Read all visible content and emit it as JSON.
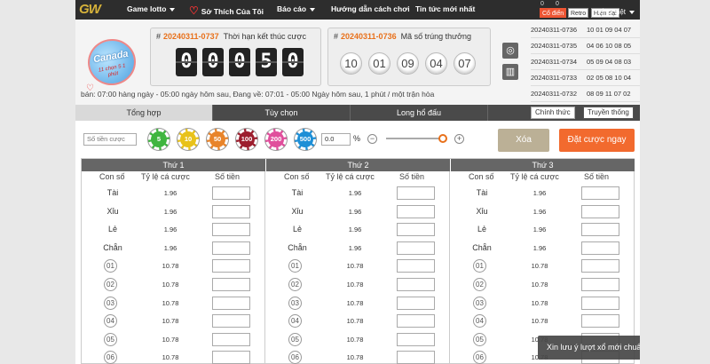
{
  "nav": {
    "logo": "GW",
    "items": [
      {
        "label": "Game lotto",
        "caret": true
      },
      {
        "label": "Sở Thích Của Tôi",
        "caret": false,
        "heart": true
      },
      {
        "label": "Báo cáo",
        "caret": true
      },
      {
        "label": "Hướng dẫn cách chơi",
        "caret": false
      },
      {
        "label": "Tin tức mới nhất",
        "caret": false
      }
    ],
    "mini_values": [
      "0",
      "0"
    ],
    "style_buttons": [
      "Cổ điển",
      "Retro",
      "Hiện đại"
    ],
    "language": "Tiếng Việt"
  },
  "badge": {
    "title": "Canada",
    "subtitle": "11 chọn 5 1 phút"
  },
  "countdown": {
    "draw_id": "20240311-0737",
    "label": "Thời hạn kết thúc cược",
    "digits": [
      "0",
      "0",
      "0",
      "5",
      "0"
    ]
  },
  "winning": {
    "draw_id": "20240311-0736",
    "label": "Mã số trúng thưởng",
    "balls": [
      "10",
      "01",
      "09",
      "04",
      "07"
    ]
  },
  "history": [
    {
      "id": "20240311-0736",
      "numbers": "10 01 09 04 07"
    },
    {
      "id": "20240311-0735",
      "numbers": "04 06 10 08 05"
    },
    {
      "id": "20240311-0734",
      "numbers": "05 09 04 08 03"
    },
    {
      "id": "20240311-0733",
      "numbers": "02 05 08 10 04"
    },
    {
      "id": "20240311-0732",
      "numbers": "08 09 11 07 02"
    }
  ],
  "info_line": "bán: 07:00 hàng ngày - 05:00 ngày hôm sau,   Đang về: 07:01 - 05:00 Ngày hôm sau, 1 phút / một trận hòa",
  "tabs": [
    "Tổng hợp",
    "Tùy chọn",
    "Long hổ đấu"
  ],
  "view_toggle": [
    "Chính thức",
    "Truyền thống"
  ],
  "controls": {
    "amount_placeholder": "Số tiền cược",
    "chips": [
      {
        "value": "5",
        "color": "#3fb53f"
      },
      {
        "value": "10",
        "color": "#e8c21a"
      },
      {
        "value": "50",
        "color": "#e8842a"
      },
      {
        "value": "100",
        "color": "#9c1e2e"
      },
      {
        "value": "200",
        "color": "#e04f9c"
      },
      {
        "value": "500",
        "color": "#1e8fd6"
      }
    ],
    "percent_value": "0.0",
    "percent_sign": "%",
    "minus": "−",
    "plus": "+",
    "clear_label": "Xóa",
    "place_label": "Đặt cược ngay"
  },
  "table": {
    "columns": [
      "Thứ 1",
      "Thứ 2",
      "Thứ 3"
    ],
    "sub_headers": [
      "Con số",
      "Tỷ lệ cá cược",
      "Số tiền"
    ],
    "rows": [
      {
        "label": "Tài",
        "odds": "1.96",
        "circle": false
      },
      {
        "label": "Xỉu",
        "odds": "1.96",
        "circle": false
      },
      {
        "label": "Lẻ",
        "odds": "1.96",
        "circle": false
      },
      {
        "label": "Chẵn",
        "odds": "1.96",
        "circle": false
      },
      {
        "label": "01",
        "odds": "10.78",
        "circle": true
      },
      {
        "label": "02",
        "odds": "10.78",
        "circle": true
      },
      {
        "label": "03",
        "odds": "10.78",
        "circle": true
      },
      {
        "label": "04",
        "odds": "10.78",
        "circle": true
      },
      {
        "label": "05",
        "odds": "10.78",
        "circle": true
      },
      {
        "label": "06",
        "odds": "10.78",
        "circle": true
      }
    ]
  },
  "toast": {
    "text": "Xin lưu ý lượt xổ mới chuẩn bị bắt đầu",
    "close": "✕"
  }
}
